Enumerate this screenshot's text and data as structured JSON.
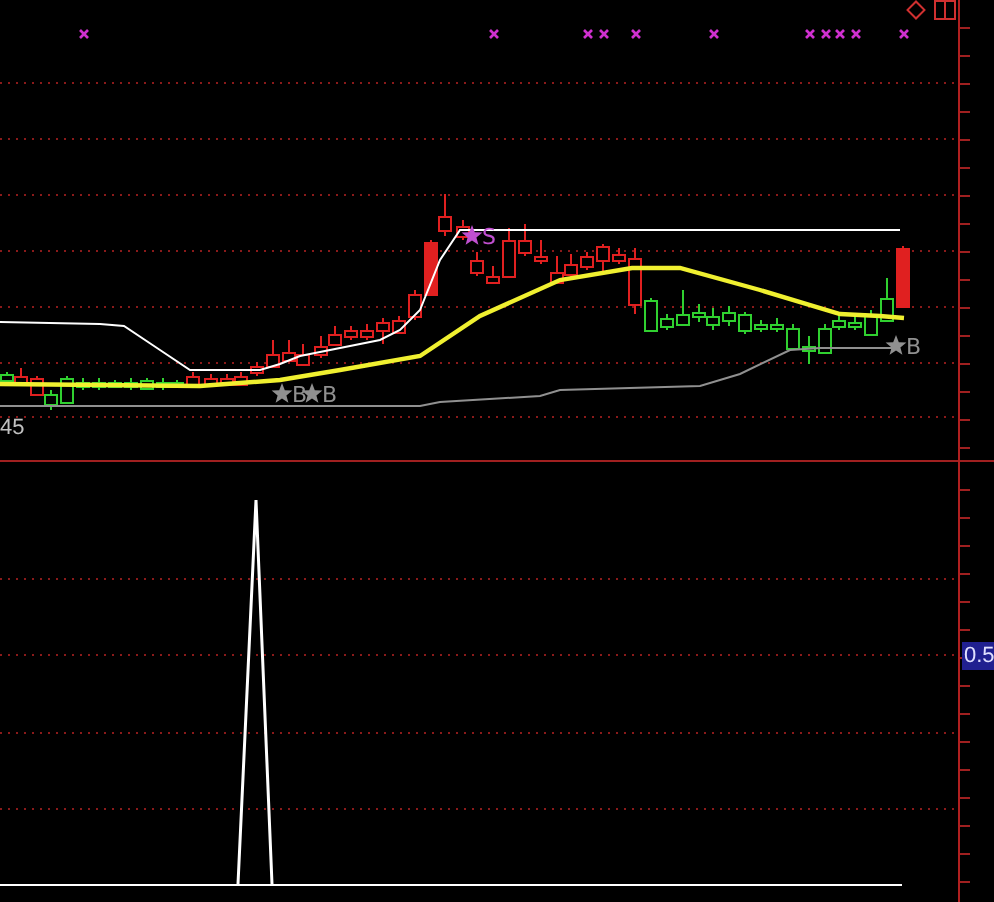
{
  "price_panel": {
    "signals": [
      {
        "label": "B",
        "color": "#909090"
      },
      {
        "label": "B",
        "color": "#909090"
      },
      {
        "label": "S",
        "color": "#c050d0"
      },
      {
        "label": "B",
        "color": "#909090"
      }
    ],
    "left_label": "45"
  },
  "indicator_panel": {
    "axis_label": "0.5"
  }
}
